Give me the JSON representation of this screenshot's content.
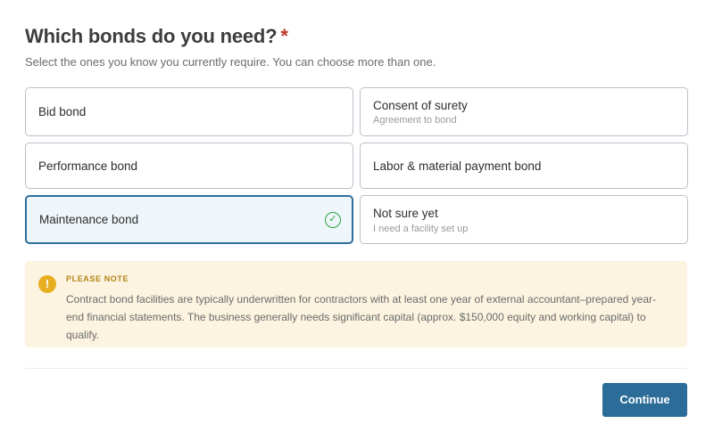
{
  "heading": {
    "title": "Which bonds do you need?",
    "required_mark": "*"
  },
  "subtitle": "Select the ones you know you currently require. You can choose more than one.",
  "options": [
    {
      "label": "Bid bond",
      "sub": "",
      "selected": false
    },
    {
      "label": "Consent of surety",
      "sub": "Agreement to bond",
      "selected": false
    },
    {
      "label": "Performance bond",
      "sub": "",
      "selected": false
    },
    {
      "label": "Labor & material payment bond",
      "sub": "",
      "selected": false
    },
    {
      "label": "Maintenance bond",
      "sub": "",
      "selected": true
    },
    {
      "label": "Not sure yet",
      "sub": "I need a facility set up",
      "selected": false
    }
  ],
  "note": {
    "icon": "exclamation-icon",
    "heading": "PLEASE NOTE",
    "body": "Contract bond facilities are typically underwritten for contractors with at least one year of external accountant–prepared year-end financial statements. The business generally needs significant capital (approx. $150,000 equity and working capital) to qualify."
  },
  "actions": {
    "continue_label": "Continue"
  },
  "colors": {
    "accent": "#2b6c99",
    "check": "#29a33a",
    "required": "#c0392b",
    "note_bg": "#fcf4e0",
    "note_icon": "#e8ae22"
  }
}
